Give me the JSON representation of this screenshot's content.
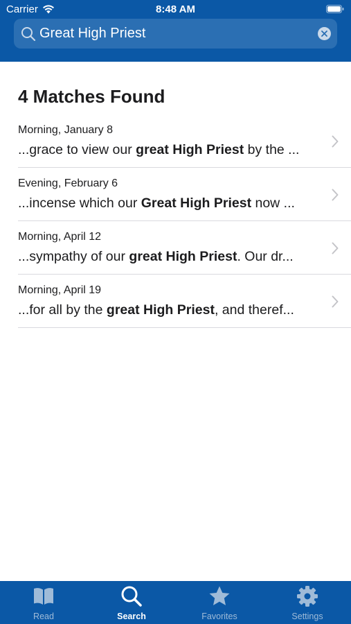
{
  "status_bar": {
    "carrier": "Carrier",
    "time": "8:48 AM"
  },
  "search": {
    "query": "Great High Priest"
  },
  "results": {
    "title": "4 Matches Found",
    "items": [
      {
        "date": "Morning, January 8",
        "pre": "...grace to view our ",
        "match": "great High Priest",
        "post": " by the ..."
      },
      {
        "date": "Evening, February 6",
        "pre": "...incense which our ",
        "match": "Great High Priest",
        "post": " now ..."
      },
      {
        "date": "Morning, April 12",
        "pre": "...sympathy of our ",
        "match": "great High Priest",
        "post": ". Our dr..."
      },
      {
        "date": "Morning, April 19",
        "pre": "...for all by the ",
        "match": "great High Priest",
        "post": ", and theref..."
      }
    ]
  },
  "tabs": [
    {
      "label": "Read",
      "icon": "book-icon",
      "active": false
    },
    {
      "label": "Search",
      "icon": "search-icon",
      "active": true
    },
    {
      "label": "Favorites",
      "icon": "star-icon",
      "active": false
    },
    {
      "label": "Settings",
      "icon": "gear-icon",
      "active": false
    }
  ],
  "colors": {
    "brand": "#0b58a6",
    "search_field": "#2b6fb3",
    "tab_inactive": "#9fbbd8"
  }
}
